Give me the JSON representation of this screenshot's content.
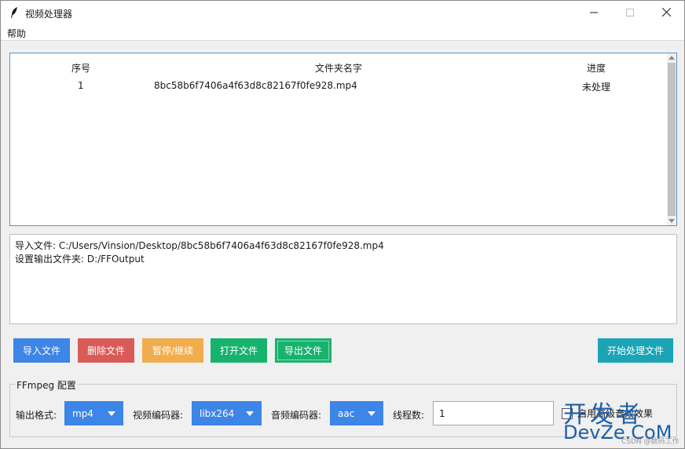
{
  "window": {
    "title": "视频处理器"
  },
  "menu": {
    "help": "帮助"
  },
  "table": {
    "columns": [
      "序号",
      "文件夹名字",
      "进度"
    ],
    "rows": [
      {
        "index": "1",
        "name": "8bc58b6f7406a4f63d8c82167f0fe928.mp4",
        "status": "未处理"
      }
    ]
  },
  "log": {
    "lines": [
      "导入文件: C:/Users/Vinsion/Desktop/8bc58b6f7406a4f63d8c82167f0fe928.mp4",
      "设置输出文件夹: D:/FFOutput"
    ]
  },
  "buttons": {
    "import": "导入文件",
    "delete": "删除文件",
    "pause": "暂停/继续",
    "open": "打开文件",
    "export": "导出文件",
    "start": "开始处理文件"
  },
  "config": {
    "title": "FFmpeg 配置",
    "format_label": "输出格式:",
    "format_value": "mp4",
    "video_codec_label": "视频编码器:",
    "video_codec_value": "libx264",
    "audio_codec_label": "音频编码器:",
    "audio_codec_value": "aac",
    "threads_label": "线程数:",
    "threads_value": "1",
    "hq_label": "启用高级音效效果"
  },
  "watermark": {
    "line1": "开发者",
    "line2": "DevZe.CoM",
    "line3": "CSDN @数码工作"
  },
  "colors": {
    "import": "#3d85e6",
    "delete": "#d95b58",
    "pause": "#f0ad4e",
    "open": "#17b36e",
    "export": "#17b36e",
    "start": "#1aa4b6",
    "combo": "#3d85e6"
  },
  "icons": {
    "app": "feather-icon",
    "minimize": "minimize-icon",
    "maximize": "maximize-icon",
    "close": "close-icon"
  }
}
